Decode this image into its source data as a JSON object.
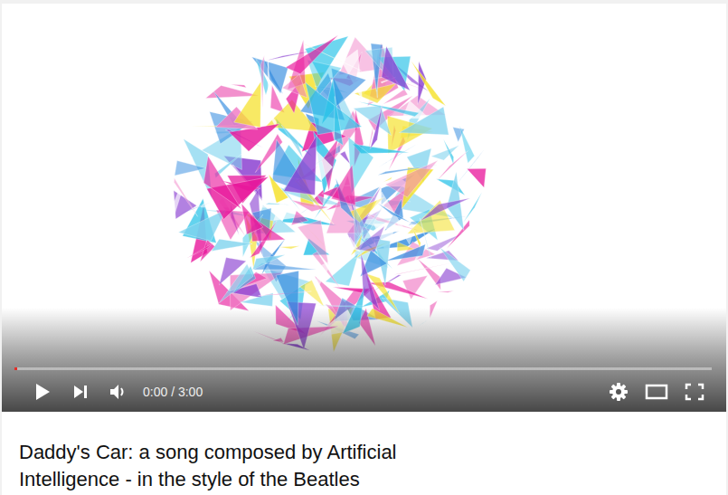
{
  "player": {
    "time": "0:00 / 3:00",
    "progress": 0.003
  },
  "video": {
    "title": "Daddy's Car: a song composed by Artificial Intelligence - in the style of the Beatles"
  }
}
